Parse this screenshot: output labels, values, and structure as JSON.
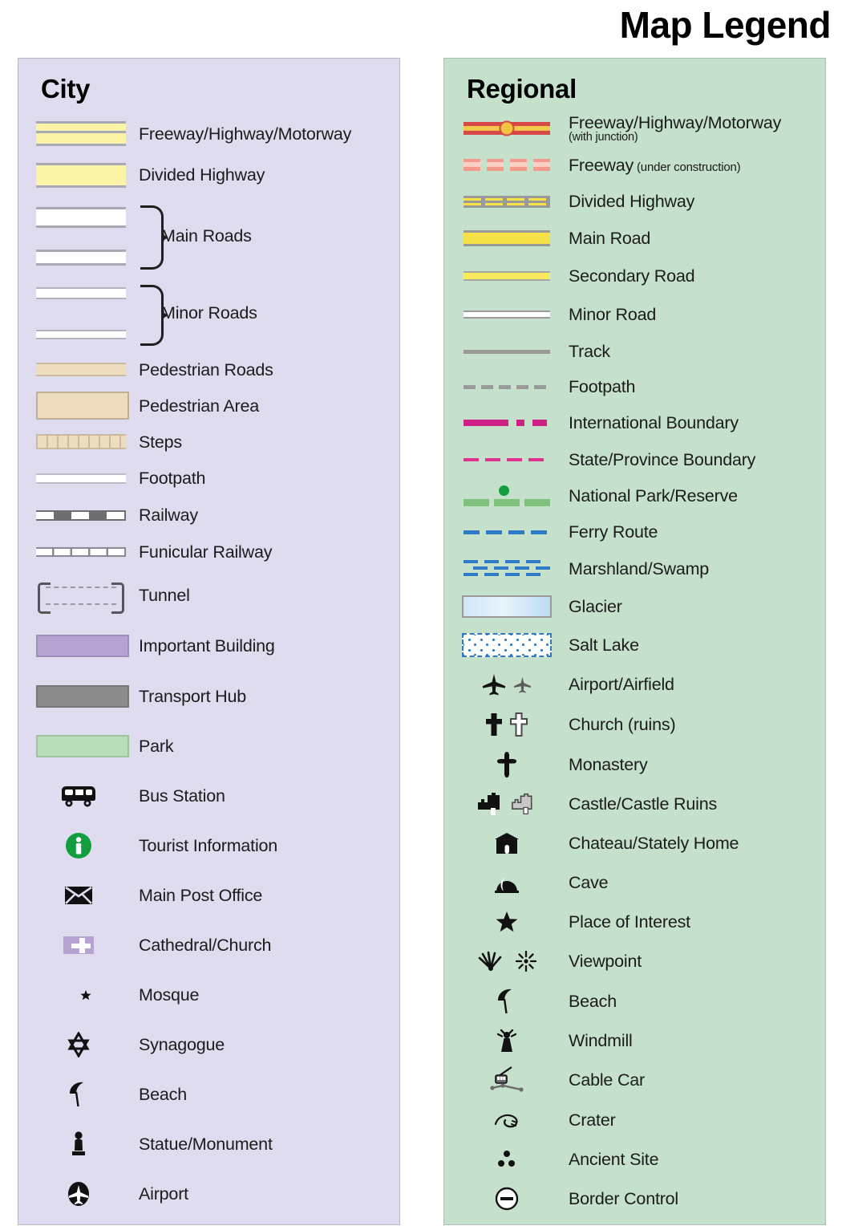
{
  "title": "Map Legend",
  "city": {
    "heading": "City",
    "bg_color": "#dedcee",
    "items": [
      {
        "label": "Freeway/Highway/Motorway",
        "symbol": "freeway-swatch"
      },
      {
        "label": "Divided Highway",
        "symbol": "divided-highway-swatch"
      },
      {
        "label": "Main Roads",
        "symbol": "main-roads-swatch-pair"
      },
      {
        "label": "Minor Roads",
        "symbol": "minor-roads-swatch-pair"
      },
      {
        "label": "Pedestrian Roads",
        "symbol": "pedestrian-road-swatch"
      },
      {
        "label": "Pedestrian Area",
        "symbol": "pedestrian-area-swatch"
      },
      {
        "label": "Steps",
        "symbol": "steps-swatch"
      },
      {
        "label": "Footpath",
        "symbol": "footpath-swatch"
      },
      {
        "label": "Railway",
        "symbol": "railway-swatch"
      },
      {
        "label": "Funicular Railway",
        "symbol": "funicular-railway-swatch"
      },
      {
        "label": "Tunnel",
        "symbol": "tunnel-swatch"
      },
      {
        "label": "Important Building",
        "symbol": "important-building-swatch"
      },
      {
        "label": "Transport Hub",
        "symbol": "transport-hub-swatch"
      },
      {
        "label": "Park",
        "symbol": "park-swatch"
      },
      {
        "label": "Bus Station",
        "symbol": "bus-icon"
      },
      {
        "label": "Tourist Information",
        "symbol": "info-icon"
      },
      {
        "label": "Main Post Office",
        "symbol": "envelope-icon"
      },
      {
        "label": "Cathedral/Church",
        "symbol": "church-cross-icon"
      },
      {
        "label": "Mosque",
        "symbol": "crescent-star-icon"
      },
      {
        "label": "Synagogue",
        "symbol": "star-of-david-icon"
      },
      {
        "label": "Beach",
        "symbol": "beach-umbrella-icon"
      },
      {
        "label": "Statue/Monument",
        "symbol": "statue-icon"
      },
      {
        "label": "Airport",
        "symbol": "airport-icon"
      }
    ]
  },
  "regional": {
    "heading": "Regional",
    "bg_color": "#c5e1cb",
    "items": [
      {
        "label": "Freeway/Highway/Motorway",
        "sub": "(with junction)",
        "symbol": "regional-freeway-junction-swatch"
      },
      {
        "label": "Freeway",
        "small": " (under construction)",
        "symbol": "regional-freeway-construction-swatch"
      },
      {
        "label": "Divided Highway",
        "symbol": "regional-divided-highway-swatch"
      },
      {
        "label": "Main Road",
        "symbol": "regional-main-road-swatch"
      },
      {
        "label": "Secondary Road",
        "symbol": "regional-secondary-road-swatch"
      },
      {
        "label": "Minor Road",
        "symbol": "regional-minor-road-swatch"
      },
      {
        "label": "Track",
        "symbol": "regional-track-swatch"
      },
      {
        "label": "Footpath",
        "symbol": "regional-footpath-swatch"
      },
      {
        "label": "International Boundary",
        "symbol": "international-boundary-swatch"
      },
      {
        "label": "State/Province Boundary",
        "symbol": "state-boundary-swatch"
      },
      {
        "label": "National Park/Reserve",
        "symbol": "national-park-swatch"
      },
      {
        "label": "Ferry Route",
        "symbol": "ferry-route-swatch"
      },
      {
        "label": "Marshland/Swamp",
        "symbol": "marshland-swatch"
      },
      {
        "label": "Glacier",
        "symbol": "glacier-swatch"
      },
      {
        "label": "Salt Lake",
        "symbol": "salt-lake-swatch"
      },
      {
        "label": "Airport/Airfield",
        "symbol": "airplane-icons"
      },
      {
        "label": "Church (ruins)",
        "symbol": "church-ruins-icons"
      },
      {
        "label": "Monastery",
        "symbol": "monastery-cross-icon"
      },
      {
        "label": "Castle/Castle Ruins",
        "symbol": "castle-icons"
      },
      {
        "label": "Chateau/Stately Home",
        "symbol": "chateau-icon"
      },
      {
        "label": "Cave",
        "symbol": "cave-icon"
      },
      {
        "label": "Place of Interest",
        "symbol": "star-icon"
      },
      {
        "label": "Viewpoint",
        "symbol": "viewpoint-icons"
      },
      {
        "label": "Beach",
        "symbol": "beach-umbrella-icon"
      },
      {
        "label": "Windmill",
        "symbol": "windmill-icon"
      },
      {
        "label": "Cable Car",
        "symbol": "cable-car-icon"
      },
      {
        "label": "Crater",
        "symbol": "crater-icon"
      },
      {
        "label": "Ancient Site",
        "symbol": "ancient-site-icon"
      },
      {
        "label": "Border Control",
        "symbol": "border-control-icon"
      }
    ]
  },
  "colors": {
    "city_panel": "#dedcee",
    "regional_panel": "#c5e1cb",
    "highway_yellow": "#fbf3a8",
    "freeway_red": "#d94848",
    "junction_yellow": "#f5c342",
    "road_yellow": "#f6e246",
    "pedestrian_tan": "#eedcbf",
    "important_building_purple": "#b7a3d1",
    "transport_hub_grey": "#8c8c8c",
    "park_green": "#b8ddb8",
    "info_green": "#129e3f",
    "boundary_magenta": "#cf1f87",
    "ferry_blue": "#2d7bc4",
    "national_park_green": "#7ec17a"
  }
}
